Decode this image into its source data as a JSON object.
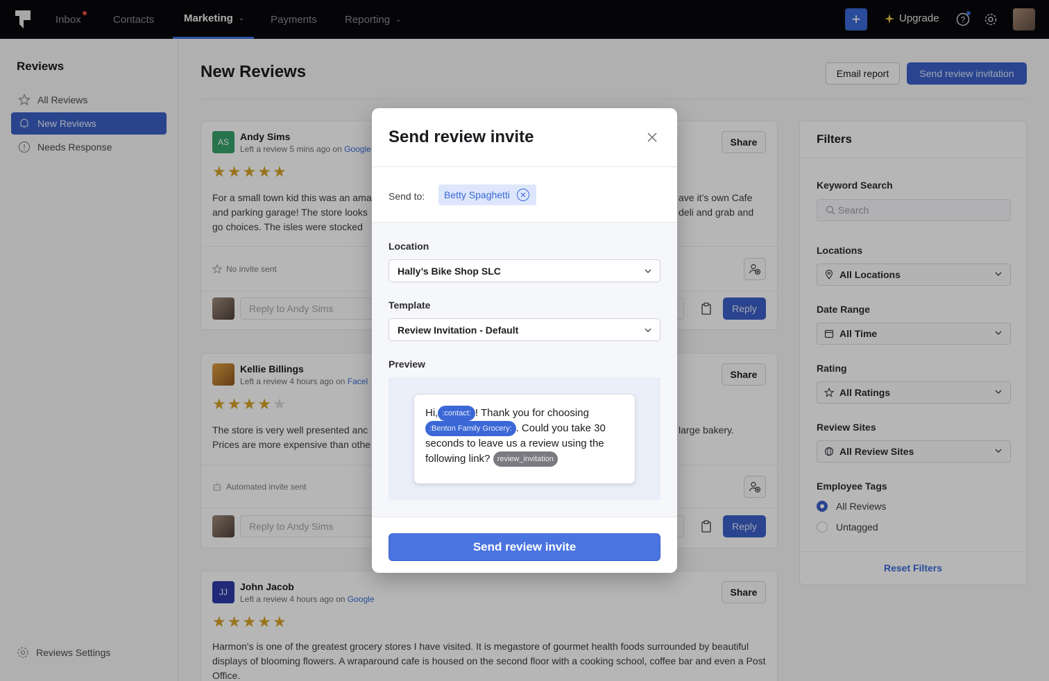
{
  "topnav": {
    "items": [
      {
        "label": "Inbox"
      },
      {
        "label": "Contacts"
      },
      {
        "label": "Marketing"
      },
      {
        "label": "Payments"
      },
      {
        "label": "Reporting"
      }
    ],
    "upgrade_label": "Upgrade",
    "add_icon": "plus-icon",
    "help_icon": "help-icon",
    "settings_icon": "gear-icon"
  },
  "sidebar": {
    "title": "Reviews",
    "items": [
      {
        "label": "All Reviews",
        "icon": "star-icon"
      },
      {
        "label": "New Reviews",
        "icon": "bell-icon"
      },
      {
        "label": "Needs Response",
        "icon": "alert-icon"
      }
    ],
    "settings_label": "Reviews Settings"
  },
  "main": {
    "title": "New Reviews",
    "email_report_label": "Email report",
    "send_invitation_label": "Send review invitation",
    "share_label": "Share",
    "reply_label": "Reply",
    "reviews": [
      {
        "initials": "AS",
        "name": "Andy Sims",
        "meta": "Left a review 5 mins ago on ",
        "source": "Google",
        "rating": 5,
        "text_left": "For a small town kid this was an ama",
        "text_left2": "and parking garage! The store looks",
        "text_left3": "go choices. The isles were stocked",
        "text_right": "ave it’s own Cafe",
        "text_right2": "deli and grab and",
        "invite_status": "No invite sent",
        "reply_placeholder": "Reply to Andy Sims"
      },
      {
        "initials": "",
        "name": "Kellie Billings",
        "meta": "Left a review 4 hours ago on ",
        "source": "Facel",
        "rating": 4,
        "text_left": "The store is very well presented anc",
        "text_left2": "Prices are more expensive than othe",
        "text_right": "large bakery.",
        "invite_status": "Automated invite sent",
        "reply_placeholder": "Reply to Andy Sims"
      },
      {
        "initials": "JJ",
        "name": "John Jacob",
        "meta": "Left a review 4 hours ago on ",
        "source": "Google",
        "rating": 5,
        "text": "Harmon's is one of the greatest grocery stores I have visited. It is megastore of gourmet health foods surrounded by beautiful displays of blooming flowers. A wraparound cafe is housed on the second floor with a cooking school, coffee bar and even a Post Office."
      }
    ]
  },
  "filters": {
    "title": "Filters",
    "keyword_label": "Keyword Search",
    "search_placeholder": "Search",
    "locations_label": "Locations",
    "locations_value": "All Locations",
    "date_label": "Date Range",
    "date_value": "All Time",
    "rating_label": "Rating",
    "rating_value": "All Ratings",
    "sites_label": "Review Sites",
    "sites_value": "All Review Sites",
    "tags_label": "Employee Tags",
    "tag_options": [
      "All Reviews",
      "Untagged"
    ],
    "tag_selected": "All Reviews",
    "reset_label": "Reset Filters"
  },
  "modal": {
    "title": "Send review invite",
    "send_to_label": "Send to:",
    "recipient": "Betty Spaghetti",
    "location_label": "Location",
    "location_value": "Hally’s Bike Shop SLC",
    "template_label": "Template",
    "template_value": "Review Invitation - Default",
    "preview_label": "Preview",
    "preview": {
      "hi": "Hi,",
      "contact_tag": ":contact:",
      "thanks": "! Thank you for choosing",
      "business_tag": ":Benton Family Grocery:",
      "rest": ". Could you take 30 seconds to leave us a review using the following link?",
      "link_tag": "review_invitation"
    },
    "submit_label": "Send review invite"
  },
  "colors": {
    "accent": "#3b5fc7",
    "star": "#d4a12a",
    "link": "#3b68d6"
  }
}
